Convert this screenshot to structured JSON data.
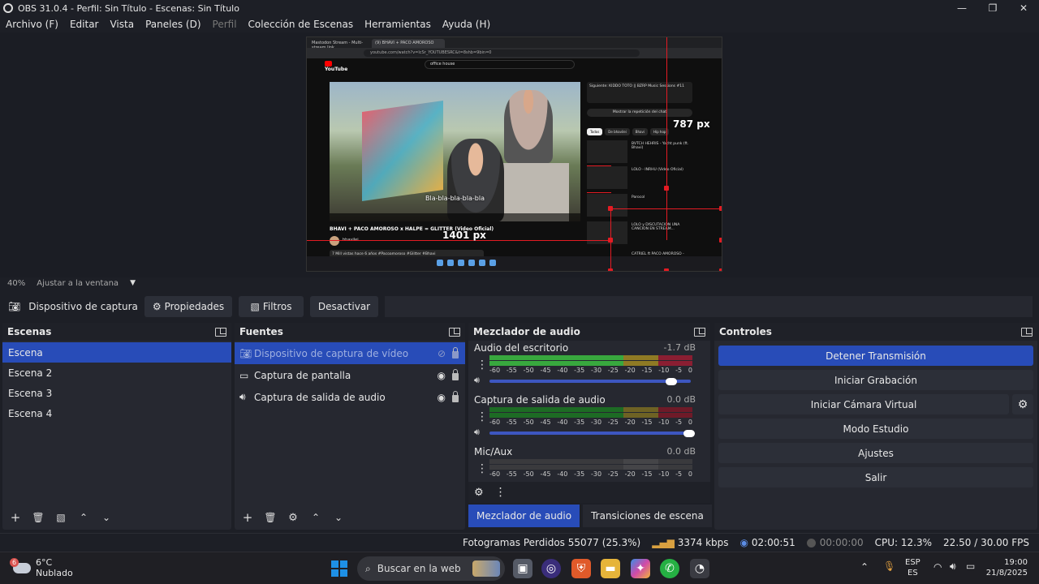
{
  "window": {
    "title": "OBS 31.0.4 - Perfil: Sin Título - Escenas: Sin Título"
  },
  "menu": [
    "Archivo (F)",
    "Editar",
    "Vista",
    "Paneles (D)",
    "Perfil",
    "Colección de Escenas",
    "Herramientas",
    "Ayuda (H)"
  ],
  "preview": {
    "browser_tab1": "Mastodon Stream - Multi-stream link",
    "browser_tab2": "(9) BHAVI + PACO AMOROSO",
    "url": "youtube.com/watch?v=lcSr_YOUTUBESRC&t=8shb=9bin=0",
    "yt_search": "office house",
    "subtitle": "Bla-bla-bla-bla-bla",
    "video_title": "BHAVI + PACO AMOROSO x HALPE = GLITTER (Video Oficial)",
    "channel": "bhavilei",
    "desc": "7 Mill vistas hace 6 años #Pacoamoroso #Glitter #Bhavi",
    "chat_label": "Mostrar la repetición del chat",
    "up_next": "Siguiente: KIDDO TOTO || BZRP Music Sessions #11",
    "chips": [
      "Todos",
      "De bhavilei",
      "Bhavi",
      "Hip hop"
    ],
    "rec_items": [
      "BVTCH HEHRIS - Yacht punk (ft. Bhavi)",
      "LOLO - INRHU (Video Oficial)",
      "Parocol",
      "LOLO y DISCUTACION UNA CANCION EN STREAM...",
      "CATRIEL ft PACO AMOROSO - "
    ],
    "measure_height": "787 px",
    "measure_width": "1401 px"
  },
  "zoom": {
    "value": "40%",
    "fit": "Ajustar a la ventana"
  },
  "source_toolbar": {
    "name": "Dispositivo de captura de v",
    "props": "Propiedades",
    "filters": "Filtros",
    "deactivate": "Desactivar"
  },
  "scenes": {
    "title": "Escenas",
    "items": [
      "Escena",
      "Escena 2",
      "Escena 3",
      "Escena 4"
    ]
  },
  "sources": {
    "title": "Fuentes",
    "items": [
      "Dispositivo de captura de vídeo",
      "Captura de pantalla",
      "Captura de salida de audio"
    ]
  },
  "mixer": {
    "title": "Mezclador de audio",
    "scale": [
      "-60",
      "-55",
      "-50",
      "-45",
      "-40",
      "-35",
      "-30",
      "-25",
      "-20",
      "-15",
      "-10",
      "-5",
      "0"
    ],
    "tracks": [
      {
        "name": "Audio del escritorio",
        "db": "-1.7 dB"
      },
      {
        "name": "Captura de salida de audio",
        "db": "0.0 dB"
      },
      {
        "name": "Mic/Aux",
        "db": "0.0 dB"
      }
    ]
  },
  "controls": {
    "title": "Controles",
    "stop_stream": "Detener Transmisión",
    "start_record": "Iniciar Grabación",
    "start_vcam": "Iniciar Cámara Virtual",
    "studio": "Modo Estudio",
    "settings": "Ajustes",
    "exit": "Salir"
  },
  "tabs": [
    "Mezclador de audio",
    "Transiciones de escena"
  ],
  "status": {
    "dropped": "Fotogramas Perdidos 55077 (25.3%)",
    "bitrate": "3374 kbps",
    "stream_time": "02:00:51",
    "rec_time": "00:00:00",
    "cpu": "CPU: 12.3%",
    "fps": "22.50 / 30.00 FPS"
  },
  "taskbar": {
    "weather_badge": "6",
    "temp": "6°C",
    "condition": "Nublado",
    "search": "Buscar en la web",
    "lang1": "ESP",
    "lang2": "ES",
    "time": "19:00",
    "date": "21/8/2025"
  },
  "colors": {
    "accent": "#284cb8",
    "record_red": "#e41b23"
  }
}
